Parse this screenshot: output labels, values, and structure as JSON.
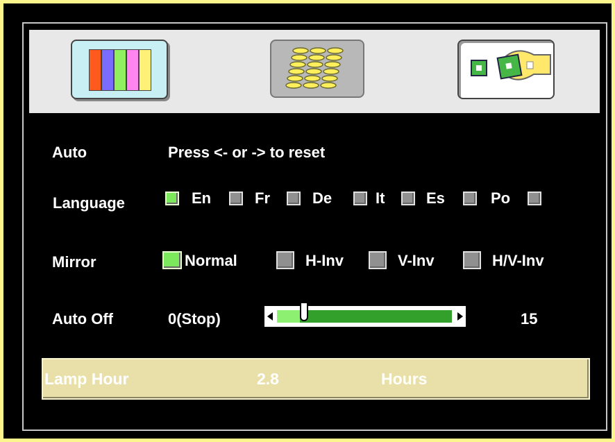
{
  "tabs": [
    {
      "name": "color-tab",
      "colors": [
        "#ff5a1e",
        "#7a6cff",
        "#90f060",
        "#ff86f0",
        "#fff078"
      ]
    },
    {
      "name": "image-tab"
    },
    {
      "name": "setup-tab",
      "selected": true
    }
  ],
  "auto": {
    "label": "Auto",
    "hint": "Press <- or -> to reset"
  },
  "language": {
    "label": "Language",
    "options": [
      "En",
      "Fr",
      "De",
      "It",
      "Es",
      "Po",
      ""
    ],
    "selected": "En"
  },
  "mirror": {
    "label": "Mirror",
    "options": [
      "Normal",
      "H-Inv",
      "V-Inv",
      "H/V-Inv"
    ],
    "selected": "Normal"
  },
  "auto_off": {
    "label": "Auto Off",
    "min_label": "0(Stop)",
    "max_label": "15",
    "value_fraction": 0.13
  },
  "lamp": {
    "label": "Lamp Hour",
    "value": "2.8",
    "unit": "Hours"
  }
}
